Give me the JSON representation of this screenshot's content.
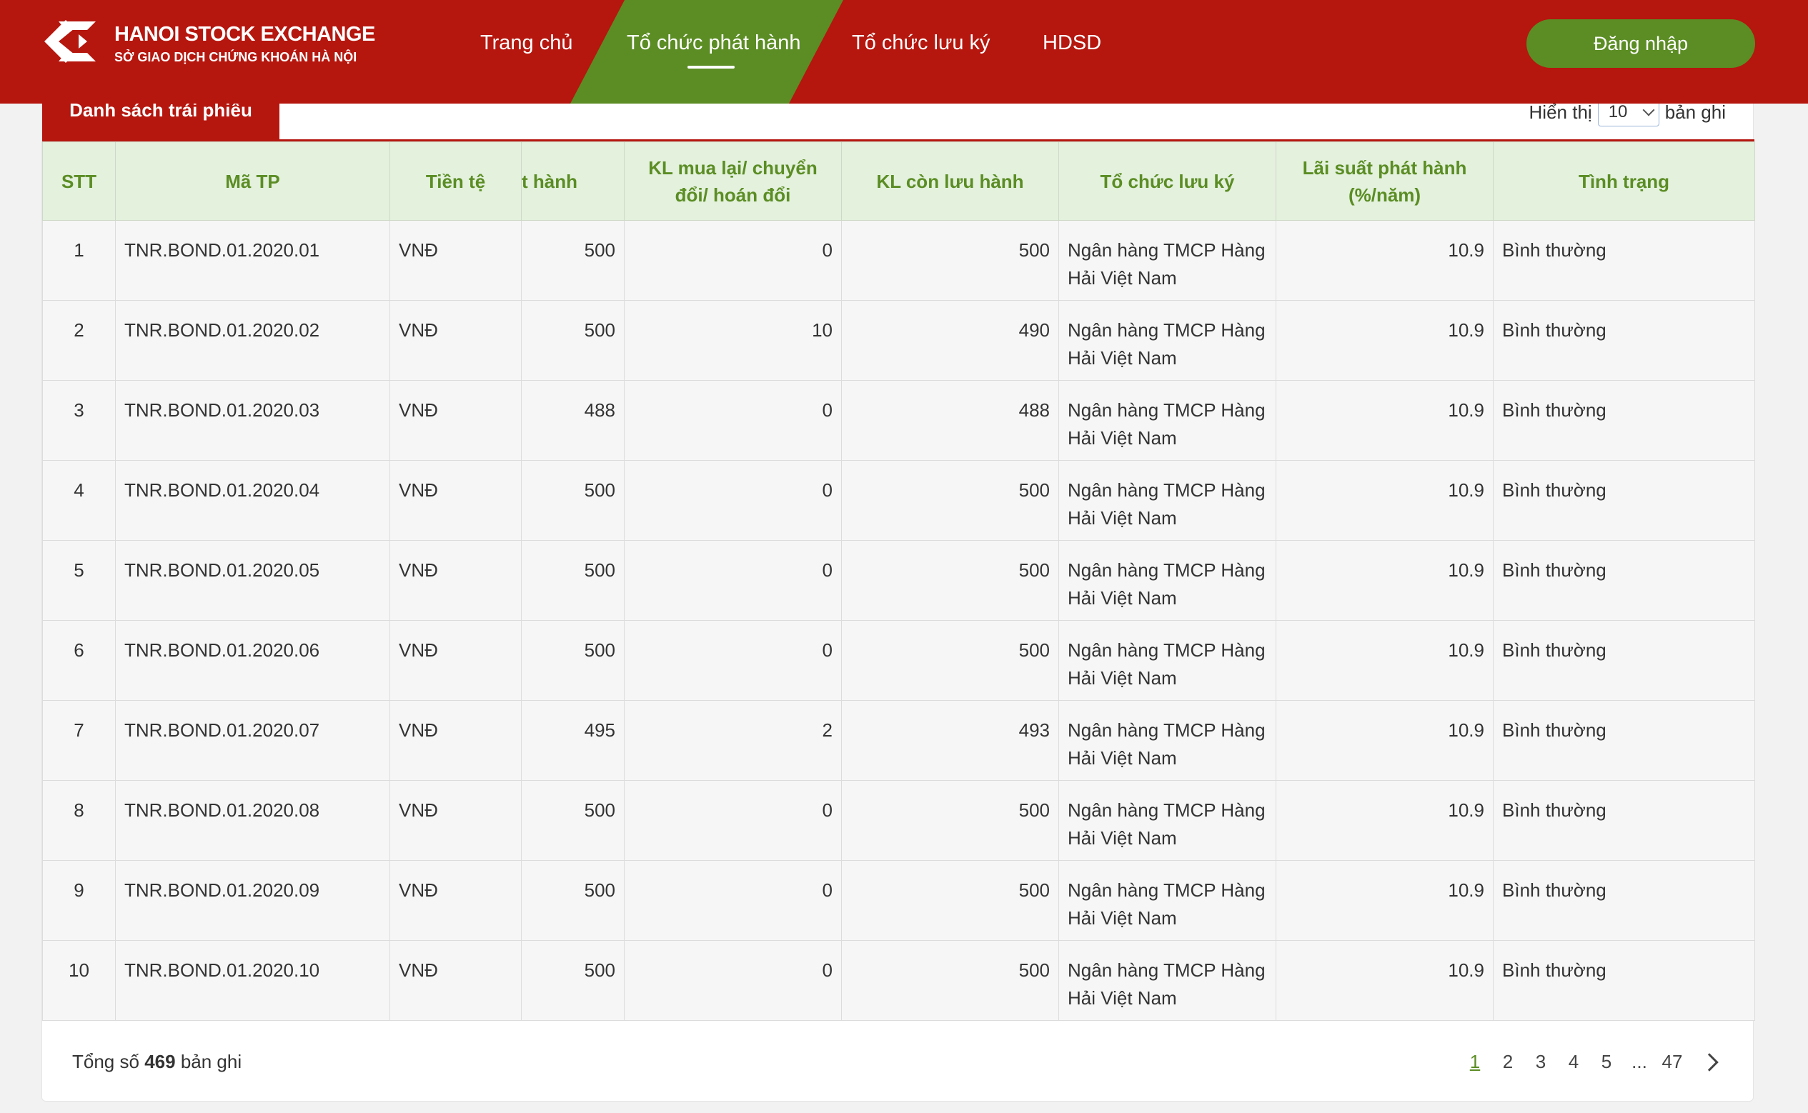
{
  "header": {
    "brand_title": "HANOI STOCK EXCHANGE",
    "brand_subtitle": "SỞ GIAO DỊCH CHỨNG KHOÁN HÀ NỘI",
    "nav": [
      "Trang chủ",
      "Tổ chức phát hành",
      "Tổ chức lưu ký",
      "HDSD"
    ],
    "active_nav": "Tổ chức phát hành",
    "login_label": "Đăng nhập"
  },
  "list": {
    "tab_label": "Danh sách trái phiếu",
    "show_label": "Hiển thị",
    "page_size": "10",
    "records_label": "bản ghi"
  },
  "table": {
    "headers": [
      "STT",
      "Mã TP",
      "Tiền tệ",
      "t hành",
      "KL mua lại/ chuyển đổi/ hoán đổi",
      "KL còn lưu hành",
      "Tổ chức lưu ký",
      "Lãi suất phát hành (%/năm)",
      "Tình trạng"
    ],
    "rows": [
      {
        "stt": "1",
        "code": "TNR.BOND.01.2020.01",
        "currency": "VNĐ",
        "issued": "500",
        "repurchased": "0",
        "outstanding": "500",
        "custodian": "Ngân hàng TMCP Hàng Hải Việt Nam",
        "rate": "10.9",
        "status": "Bình thường"
      },
      {
        "stt": "2",
        "code": "TNR.BOND.01.2020.02",
        "currency": "VNĐ",
        "issued": "500",
        "repurchased": "10",
        "outstanding": "490",
        "custodian": "Ngân hàng TMCP Hàng Hải Việt Nam",
        "rate": "10.9",
        "status": "Bình thường"
      },
      {
        "stt": "3",
        "code": "TNR.BOND.01.2020.03",
        "currency": "VNĐ",
        "issued": "488",
        "repurchased": "0",
        "outstanding": "488",
        "custodian": "Ngân hàng TMCP Hàng Hải Việt Nam",
        "rate": "10.9",
        "status": "Bình thường"
      },
      {
        "stt": "4",
        "code": "TNR.BOND.01.2020.04",
        "currency": "VNĐ",
        "issued": "500",
        "repurchased": "0",
        "outstanding": "500",
        "custodian": "Ngân hàng TMCP Hàng Hải Việt Nam",
        "rate": "10.9",
        "status": "Bình thường"
      },
      {
        "stt": "5",
        "code": "TNR.BOND.01.2020.05",
        "currency": "VNĐ",
        "issued": "500",
        "repurchased": "0",
        "outstanding": "500",
        "custodian": "Ngân hàng TMCP Hàng Hải Việt Nam",
        "rate": "10.9",
        "status": "Bình thường"
      },
      {
        "stt": "6",
        "code": "TNR.BOND.01.2020.06",
        "currency": "VNĐ",
        "issued": "500",
        "repurchased": "0",
        "outstanding": "500",
        "custodian": "Ngân hàng TMCP Hàng Hải Việt Nam",
        "rate": "10.9",
        "status": "Bình thường"
      },
      {
        "stt": "7",
        "code": "TNR.BOND.01.2020.07",
        "currency": "VNĐ",
        "issued": "495",
        "repurchased": "2",
        "outstanding": "493",
        "custodian": "Ngân hàng TMCP Hàng Hải Việt Nam",
        "rate": "10.9",
        "status": "Bình thường"
      },
      {
        "stt": "8",
        "code": "TNR.BOND.01.2020.08",
        "currency": "VNĐ",
        "issued": "500",
        "repurchased": "0",
        "outstanding": "500",
        "custodian": "Ngân hàng TMCP Hàng Hải Việt Nam",
        "rate": "10.9",
        "status": "Bình thường"
      },
      {
        "stt": "9",
        "code": "TNR.BOND.01.2020.09",
        "currency": "VNĐ",
        "issued": "500",
        "repurchased": "0",
        "outstanding": "500",
        "custodian": "Ngân hàng TMCP Hàng Hải Việt Nam",
        "rate": "10.9",
        "status": "Bình thường"
      },
      {
        "stt": "10",
        "code": "TNR.BOND.01.2020.10",
        "currency": "VNĐ",
        "issued": "500",
        "repurchased": "0",
        "outstanding": "500",
        "custodian": "Ngân hàng TMCP Hàng Hải Việt Nam",
        "rate": "10.9",
        "status": "Bình thường"
      }
    ]
  },
  "footer": {
    "total_prefix": "Tổng số",
    "total_count": "469",
    "total_suffix": "bản ghi",
    "pages": [
      "1",
      "2",
      "3",
      "4",
      "5",
      "...",
      "47"
    ],
    "current_page": "1",
    "next_icon": "chevron-right-icon"
  },
  "colors": {
    "header_red": "#b5160e",
    "accent_green": "#5b8d24",
    "table_header_bg": "#e3f1dd"
  }
}
